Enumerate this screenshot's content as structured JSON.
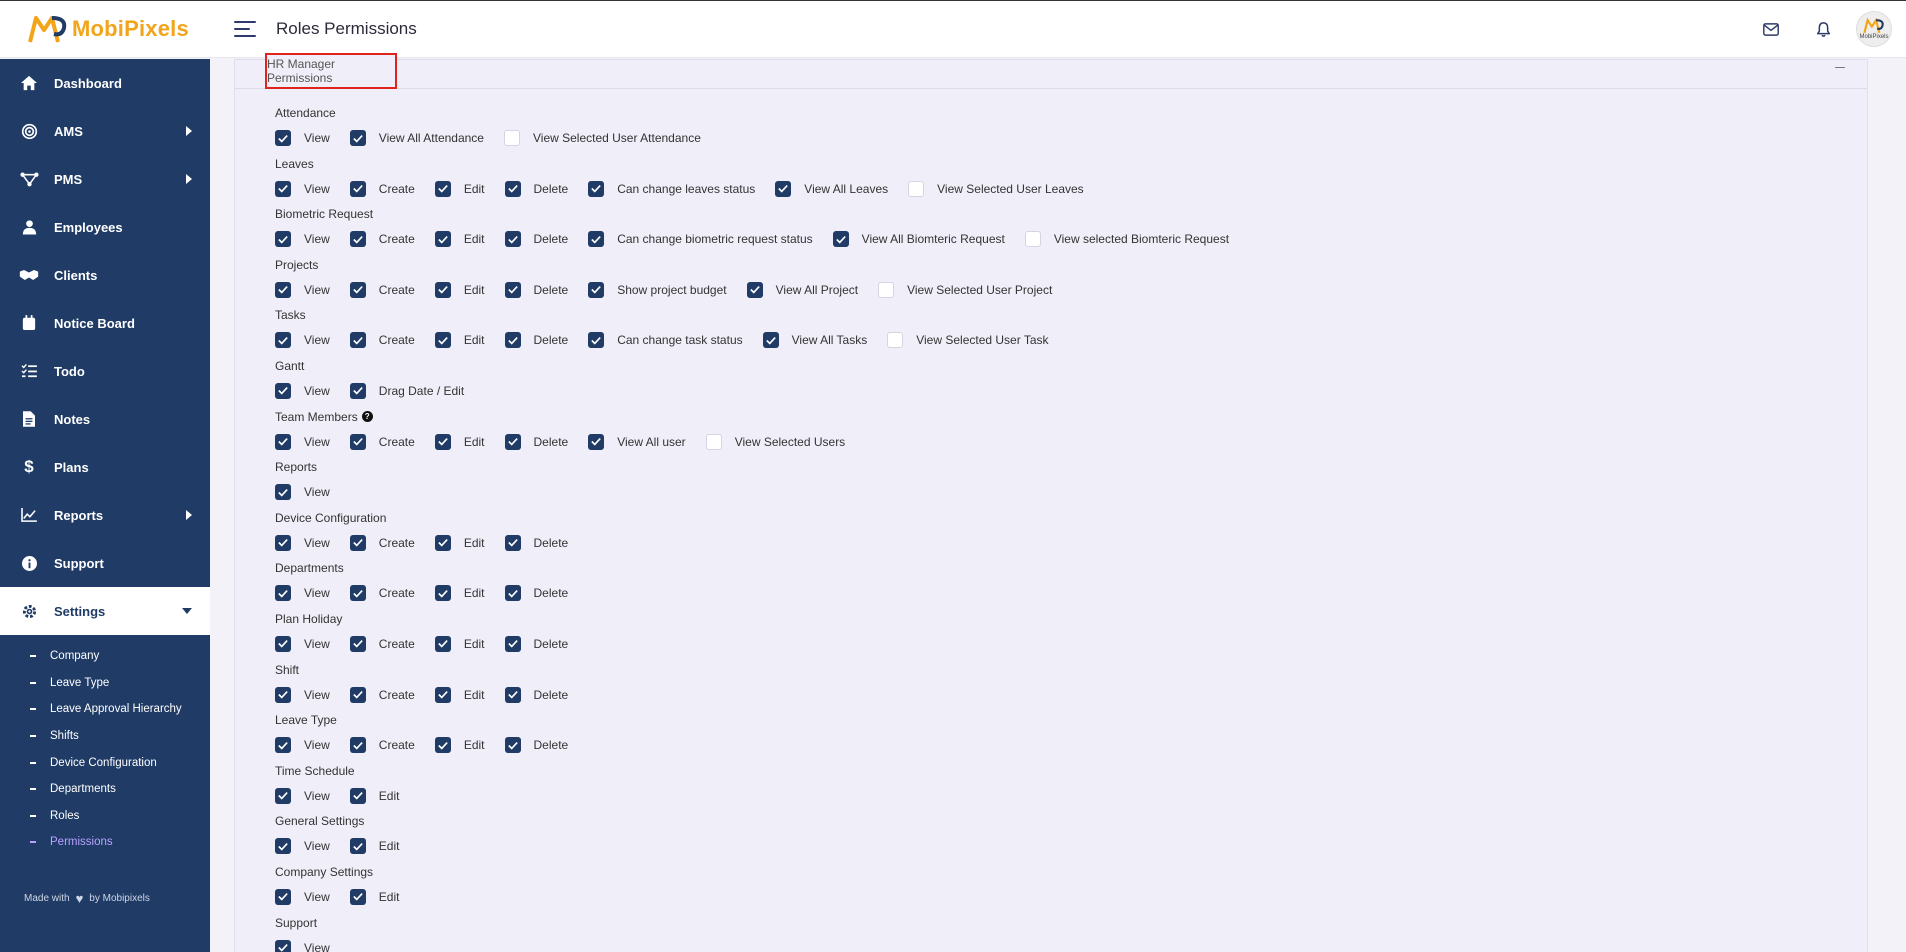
{
  "brand": {
    "name_part1": "Mobi",
    "name_part2": "Pixels"
  },
  "header": {
    "title": "Roles Permissions",
    "avatar_text": "MobiPixels"
  },
  "sidebar": {
    "items": [
      {
        "label": "Dashboard",
        "icon": "home-icon"
      },
      {
        "label": "AMS",
        "icon": "fingerprint-icon",
        "has_arrow": true
      },
      {
        "label": "PMS",
        "icon": "project-icon",
        "has_arrow": true
      },
      {
        "label": "Employees",
        "icon": "user-icon"
      },
      {
        "label": "Clients",
        "icon": "handshake-icon"
      },
      {
        "label": "Notice Board",
        "icon": "calendar-icon"
      },
      {
        "label": "Todo",
        "icon": "list-icon"
      },
      {
        "label": "Notes",
        "icon": "notes-icon"
      },
      {
        "label": "Plans",
        "icon": "dollar-icon"
      },
      {
        "label": "Reports",
        "icon": "chart-icon",
        "has_arrow": true
      },
      {
        "label": "Support",
        "icon": "info-icon"
      },
      {
        "label": "Settings",
        "icon": "gear-icon",
        "has_arrow": true,
        "active": true
      }
    ],
    "sub_items": [
      "Company",
      "Leave Type",
      "Leave Approval Hierarchy",
      "Shifts",
      "Device Configuration",
      "Departments",
      "Roles",
      "Permissions"
    ],
    "current_sub": "Permissions",
    "footer_left": "Made with",
    "footer_right": "by Mobipixels"
  },
  "role": {
    "title": "HR Manager Permissions"
  },
  "permissions": [
    {
      "module": "Attendance",
      "options": [
        [
          "View",
          true
        ],
        [
          "View All Attendance",
          true
        ],
        [
          "View Selected User Attendance",
          false
        ]
      ]
    },
    {
      "module": "Leaves",
      "options": [
        [
          "View",
          true
        ],
        [
          "Create",
          true
        ],
        [
          "Edit",
          true
        ],
        [
          "Delete",
          true
        ],
        [
          "Can change leaves status",
          true
        ],
        [
          "View All Leaves",
          true
        ],
        [
          "View Selected User Leaves",
          false
        ]
      ]
    },
    {
      "module": "Biometric Request",
      "options": [
        [
          "View",
          true
        ],
        [
          "Create",
          true
        ],
        [
          "Edit",
          true
        ],
        [
          "Delete",
          true
        ],
        [
          "Can change biometric request status",
          true
        ],
        [
          "View All Biomteric Request",
          true
        ],
        [
          "View selected Biomteric Request",
          false
        ]
      ]
    },
    {
      "module": "Projects",
      "options": [
        [
          "View",
          true
        ],
        [
          "Create",
          true
        ],
        [
          "Edit",
          true
        ],
        [
          "Delete",
          true
        ],
        [
          "Show project budget",
          true
        ],
        [
          "View All Project",
          true
        ],
        [
          "View Selected User Project",
          false
        ]
      ]
    },
    {
      "module": "Tasks",
      "options": [
        [
          "View",
          true
        ],
        [
          "Create",
          true
        ],
        [
          "Edit",
          true
        ],
        [
          "Delete",
          true
        ],
        [
          "Can change task status",
          true
        ],
        [
          "View All Tasks",
          true
        ],
        [
          "View Selected User Task",
          false
        ]
      ]
    },
    {
      "module": "Gantt",
      "options": [
        [
          "View",
          true
        ],
        [
          "Drag Date / Edit",
          true
        ]
      ]
    },
    {
      "module": "Team Members",
      "help": "?",
      "options": [
        [
          "View",
          true
        ],
        [
          "Create",
          true
        ],
        [
          "Edit",
          true
        ],
        [
          "Delete",
          true
        ],
        [
          "View All user",
          true
        ],
        [
          "View Selected Users",
          false
        ]
      ]
    },
    {
      "module": "Reports",
      "options": [
        [
          "View",
          true
        ]
      ]
    },
    {
      "module": "Device Configuration",
      "options": [
        [
          "View",
          true
        ],
        [
          "Create",
          true
        ],
        [
          "Edit",
          true
        ],
        [
          "Delete",
          true
        ]
      ]
    },
    {
      "module": "Departments",
      "options": [
        [
          "View",
          true
        ],
        [
          "Create",
          true
        ],
        [
          "Edit",
          true
        ],
        [
          "Delete",
          true
        ]
      ]
    },
    {
      "module": "Plan Holiday",
      "options": [
        [
          "View",
          true
        ],
        [
          "Create",
          true
        ],
        [
          "Edit",
          true
        ],
        [
          "Delete",
          true
        ]
      ]
    },
    {
      "module": "Shift",
      "options": [
        [
          "View",
          true
        ],
        [
          "Create",
          true
        ],
        [
          "Edit",
          true
        ],
        [
          "Delete",
          true
        ]
      ]
    },
    {
      "module": "Leave Type",
      "options": [
        [
          "View",
          true
        ],
        [
          "Create",
          true
        ],
        [
          "Edit",
          true
        ],
        [
          "Delete",
          true
        ]
      ]
    },
    {
      "module": "Time Schedule",
      "options": [
        [
          "View",
          true
        ],
        [
          "Edit",
          true
        ]
      ]
    },
    {
      "module": "General Settings",
      "options": [
        [
          "View",
          true
        ],
        [
          "Edit",
          true
        ]
      ]
    },
    {
      "module": "Company Settings",
      "options": [
        [
          "View",
          true
        ],
        [
          "Edit",
          true
        ]
      ]
    },
    {
      "module": "Support",
      "options": [
        [
          "View",
          true
        ]
      ]
    }
  ],
  "colors": {
    "sidebar_bg": "#1f3b66",
    "accent": "#1f3b66",
    "brand": "#f2a41a",
    "highlight_border": "#e0241b",
    "current_sub": "#b9a3ff"
  }
}
